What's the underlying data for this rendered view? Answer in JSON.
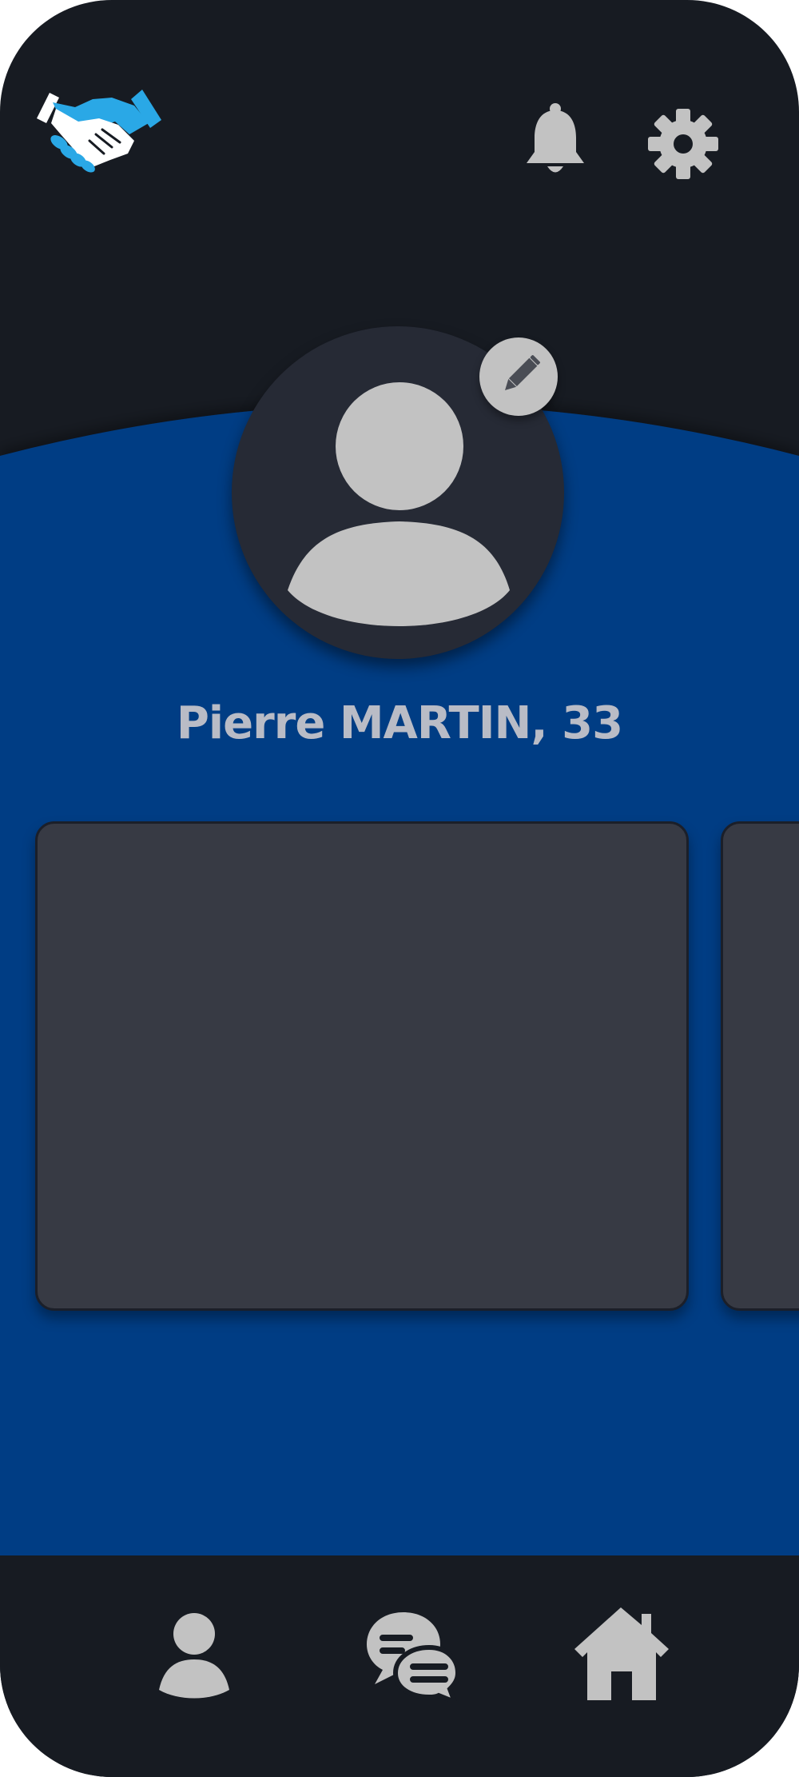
{
  "app": {
    "logo_icon": "handshake-icon",
    "colors": {
      "background_dark": "#171b22",
      "accent_blue": "#053e84",
      "logo_blue": "#2aa8e6",
      "card": "#373a44",
      "icon_gray": "#c2c2c2",
      "name_text": "#b9bcc6"
    }
  },
  "header": {
    "notification_icon": "bell-icon",
    "settings_icon": "gear-icon"
  },
  "profile": {
    "name_age": "Pierre MARTIN, 33",
    "avatar_icon": "user-avatar-icon",
    "edit_icon": "pencil-icon"
  },
  "cards": [
    {
      "id": "card-1"
    },
    {
      "id": "card-2"
    }
  ],
  "bottom_nav": {
    "items": [
      {
        "icon": "user-icon"
      },
      {
        "icon": "chat-bubbles-icon"
      },
      {
        "icon": "home-icon"
      }
    ]
  }
}
